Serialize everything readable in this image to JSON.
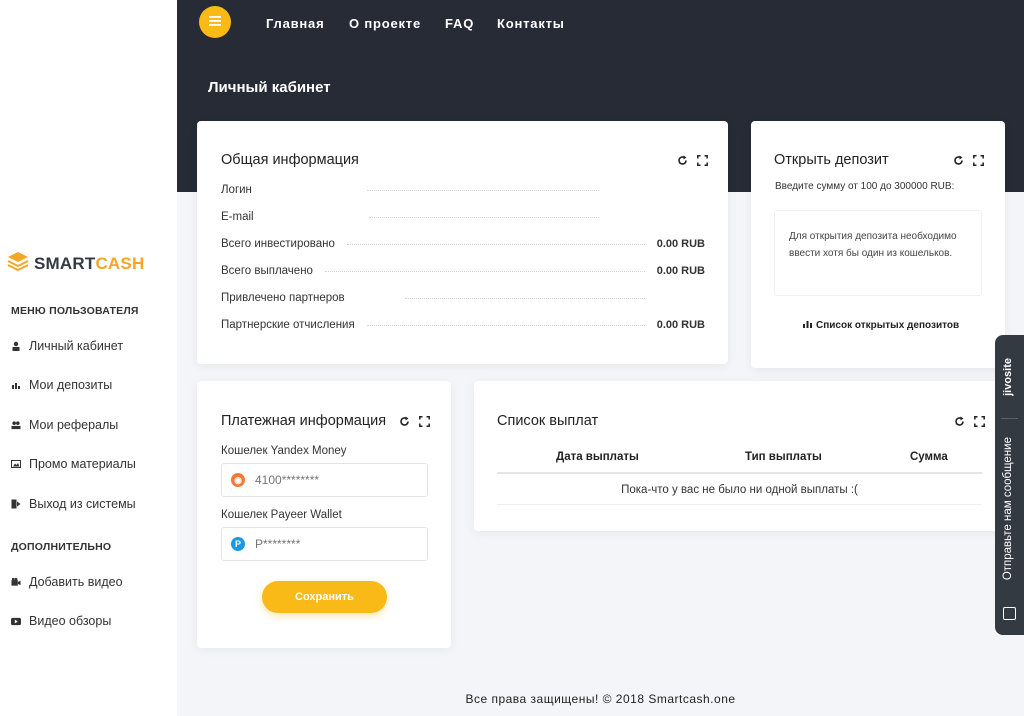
{
  "brand": {
    "name_part1": "SMART",
    "name_part2": "CASH",
    "logo_color": "#f5a623"
  },
  "nav": {
    "menu_icon": "hamburger-icon",
    "links": [
      "Главная",
      "О проекте",
      "FAQ",
      "Контакты"
    ]
  },
  "page_title": "Личный кабинет",
  "sidebar": {
    "section_user": "МЕНЮ ПОЛЬЗОВАТЕЛЯ",
    "user_items": [
      {
        "label": "Личный кабинет",
        "icon": "user-icon"
      },
      {
        "label": "Мои депозиты",
        "icon": "bar-chart-icon"
      },
      {
        "label": "Мои рефералы",
        "icon": "users-icon"
      },
      {
        "label": "Промо материалы",
        "icon": "image-icon"
      },
      {
        "label": "Выход из системы",
        "icon": "logout-icon"
      }
    ],
    "section_extra": "ДОПОЛНИТЕЛЬНО",
    "extra_items": [
      {
        "label": "Добавить видео",
        "icon": "video-camera-icon"
      },
      {
        "label": "Видео обзоры",
        "icon": "youtube-icon"
      }
    ]
  },
  "general_info": {
    "title": "Общая информация",
    "rows": [
      {
        "label": "Логин",
        "value": ""
      },
      {
        "label": "E-mail",
        "value": ""
      },
      {
        "label": "Всего инвестировано",
        "value": "0.00 RUB"
      },
      {
        "label": "Всего выплачено",
        "value": "0.00 RUB"
      },
      {
        "label": "Привлечено партнеров",
        "value": ""
      },
      {
        "label": "Партнерские отчисления",
        "value": "0.00 RUB"
      }
    ]
  },
  "open_deposit": {
    "title": "Открыть депозит",
    "hint": "Введите сумму от 100 до 300000 RUB:",
    "notice": "Для открытия депозита необходимо ввести хотя бы один из кошельков.",
    "link": "Список открытых депозитов"
  },
  "payment_info": {
    "title": "Платежная информация",
    "yandex_label": "Кошелек Yandex Money",
    "yandex_placeholder": "4100********",
    "payeer_label": "Кошелек Payeer Wallet",
    "payeer_placeholder": "P********",
    "save_label": "Сохранить"
  },
  "payouts": {
    "title": "Список выплат",
    "columns": [
      "Дата выплаты",
      "Тип выплаты",
      "Сумма"
    ],
    "empty": "Пока-что у вас не было ни одной выплаты :("
  },
  "footer": "Все права защищены! © 2018 Smartcash.one",
  "chat": {
    "brand": "jivosite",
    "message": "Отправьте нам сообщение"
  },
  "colors": {
    "accent": "#f9b916",
    "header_bg": "#272b36"
  }
}
